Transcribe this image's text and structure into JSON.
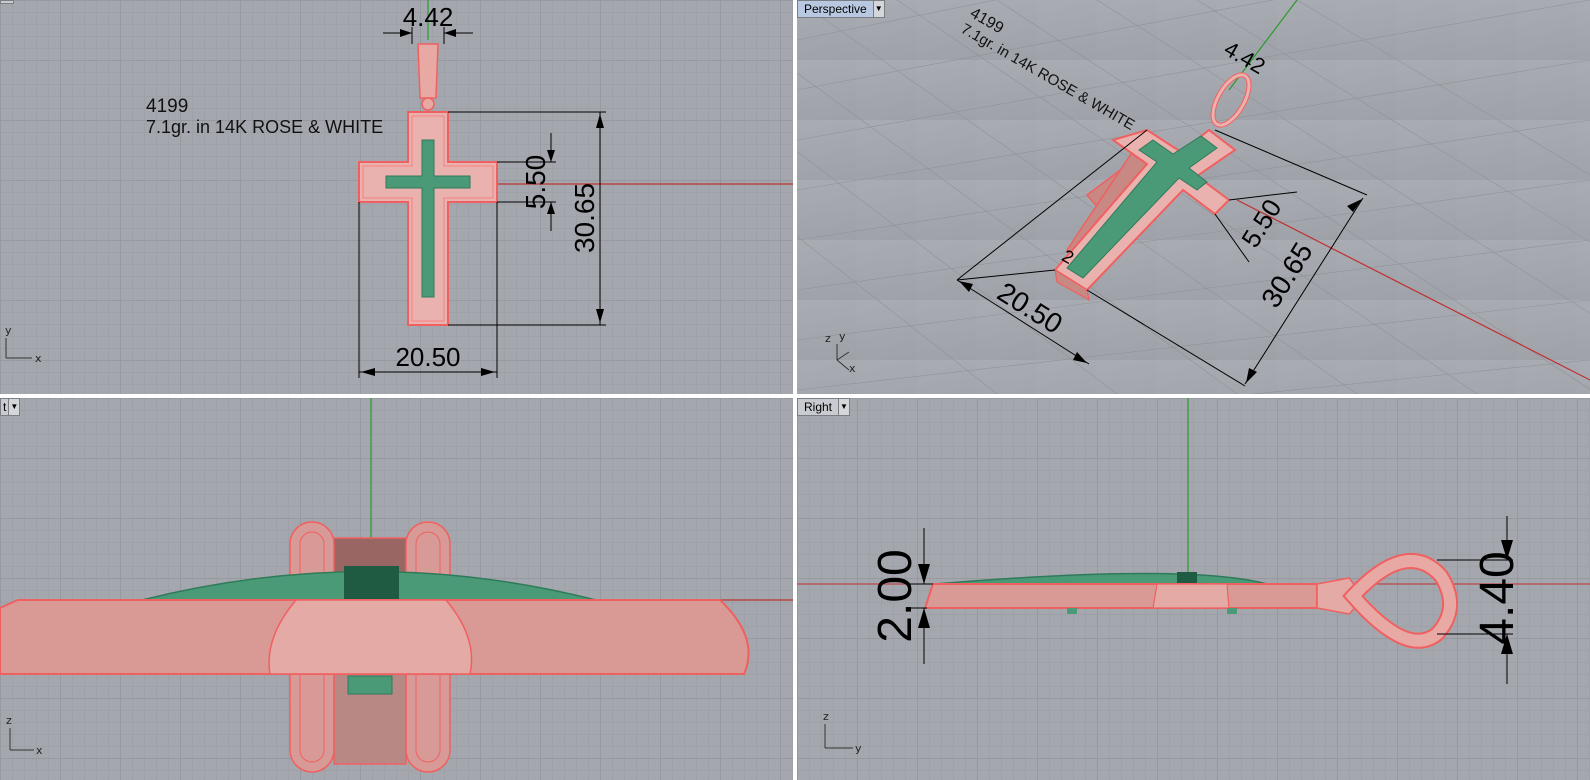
{
  "viewports": {
    "top": {
      "label": ""
    },
    "perspective": {
      "label": "Perspective"
    },
    "front": {
      "label": "t"
    },
    "right": {
      "label": "Right"
    }
  },
  "annotation": {
    "part_number": "4199",
    "description": "7.1gr. in 14K ROSE & WHITE"
  },
  "dimensions": {
    "bail_width": "4.42",
    "arm_height": "5.50",
    "total_height": "30.65",
    "total_width": "20.50",
    "thickness": "2.00",
    "bail_height": "4.40",
    "perspective_small": "2"
  },
  "axis_labels": {
    "x": "x",
    "y": "y",
    "z": "z"
  },
  "colors": {
    "background": "#a4a8ae",
    "rose_gold": "#e8a8a4",
    "rose_outline": "#f06060",
    "enamel": "#4a9a78",
    "green_axis": "#2a9a2a",
    "red_axis": "#c03030"
  }
}
